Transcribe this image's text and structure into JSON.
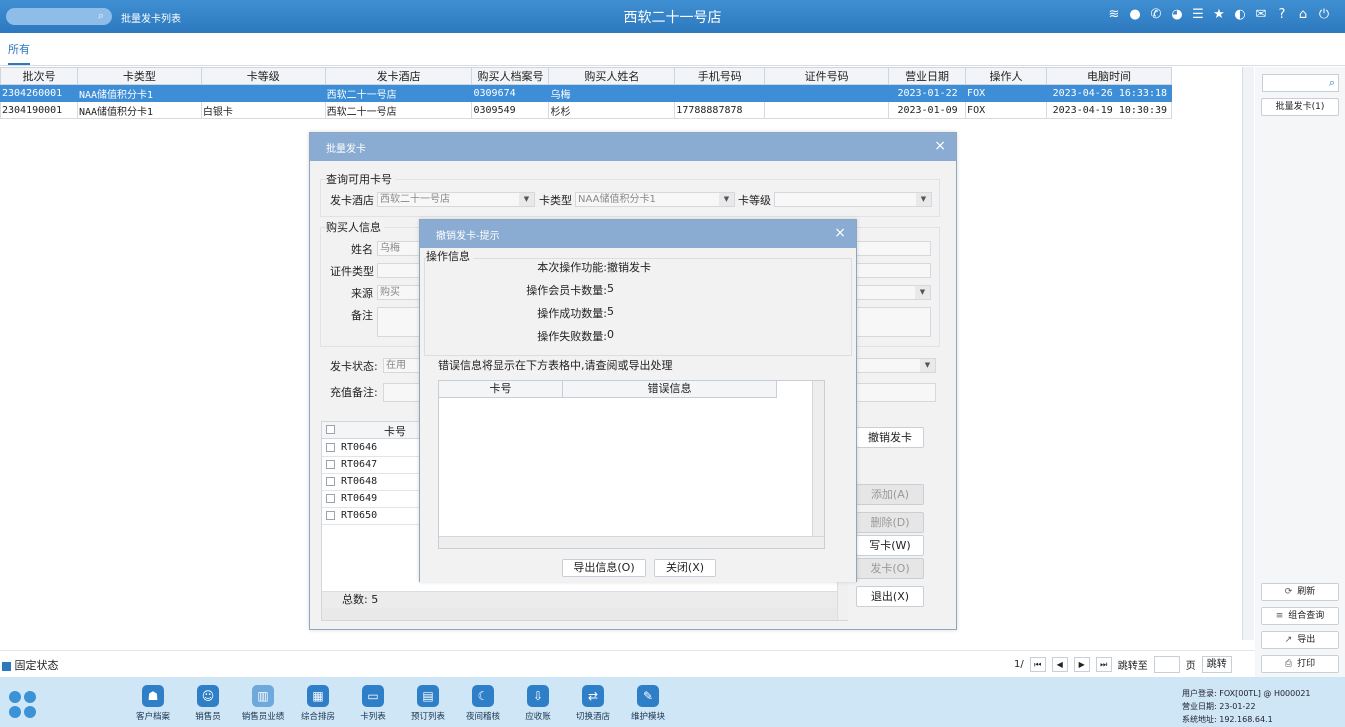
{
  "topbar": {
    "breadcrumb": "批量发卡列表",
    "app_title": "西软二十一号店",
    "icons": [
      "wifi-icon",
      "chat-icon",
      "phone-icon",
      "palette-icon",
      "menu-icon",
      "star-icon",
      "contrast-icon",
      "mail-icon",
      "help-icon",
      "home-icon",
      "power-icon"
    ]
  },
  "tabs": {
    "all": "所有"
  },
  "grid": {
    "columns": [
      "批次号",
      "卡类型",
      "卡等级",
      "发卡酒店",
      "购买人档案号",
      "购买人姓名",
      "手机号码",
      "证件号码",
      "营业日期",
      "操作人",
      "电脑时间"
    ],
    "rows": [
      [
        "2304260001",
        "NAA储值积分卡1",
        "",
        "西软二十一号店",
        "0309674",
        "乌梅",
        "",
        "",
        "2023-01-22",
        "FOX",
        "2023-04-26 16:33:18"
      ],
      [
        "2304190001",
        "NAA储值积分卡1",
        "白银卡",
        "西软二十一号店",
        "0309549",
        "杉杉",
        "17788887878",
        "",
        "2023-01-09",
        "FOX",
        "2023-04-19 10:30:39"
      ]
    ]
  },
  "right_panel": {
    "batch_button": "批量发卡(1)",
    "refresh": "刷新",
    "combo_query": "组合查询",
    "export": "导出",
    "print": "打印"
  },
  "bottom": {
    "fixed_state": "固定状态",
    "page_indicator": "1/",
    "jump_to": "跳转至",
    "page_unit": "页",
    "jump_button": "跳转"
  },
  "dock": {
    "items": [
      "客户档案",
      "销售员",
      "销售员业绩",
      "综合排房",
      "卡列表",
      "预订列表",
      "夜间稽核",
      "应收账",
      "切换酒店",
      "维护模块"
    ],
    "info": [
      "用户登录: FOX[00TL] @ H000021",
      "营业日期: 23-01-22",
      "系统地址: 192.168.64.1"
    ]
  },
  "dialog_batch": {
    "title": "批量发卡",
    "query_section": "查询可用卡号",
    "hotel_label": "发卡酒店",
    "hotel_value": "西软二十一号店",
    "type_label": "卡类型",
    "type_value": "NAA储值积分卡1",
    "level_label": "卡等级",
    "buyer_section": "购买人信息",
    "name_label": "姓名",
    "name_value": "乌梅",
    "id_type_label": "证件类型",
    "source_label": "来源",
    "source_value": "购买",
    "remark_label": "备注",
    "status_label": "发卡状态:",
    "status_value": "在用",
    "recharge_label": "充值备注:",
    "card_col": "卡号",
    "cards": [
      "RT0646",
      "RT0647",
      "RT0648",
      "RT0649",
      "RT0650"
    ],
    "total": "总数: 5",
    "btn_cancel_issue": "撤销发卡",
    "btn_add": "添加(A)",
    "btn_delete": "删除(D)",
    "btn_write": "写卡(W)",
    "btn_issue": "发卡(O)",
    "btn_exit": "退出(X)"
  },
  "dialog_prompt": {
    "title": "撤销发卡-提示",
    "section": "操作信息",
    "func_label": "本次操作功能:",
    "func_value": "撤销发卡",
    "count_label": "操作会员卡数量:",
    "count_value": "5",
    "success_label": "操作成功数量:",
    "success_value": "5",
    "fail_label": "操作失败数量:",
    "fail_value": "0",
    "note": "错误信息将显示在下方表格中,请查阅或导出处理",
    "col_card": "卡号",
    "col_error": "错误信息",
    "btn_export": "导出信息(O)",
    "btn_close": "关闭(X)"
  }
}
